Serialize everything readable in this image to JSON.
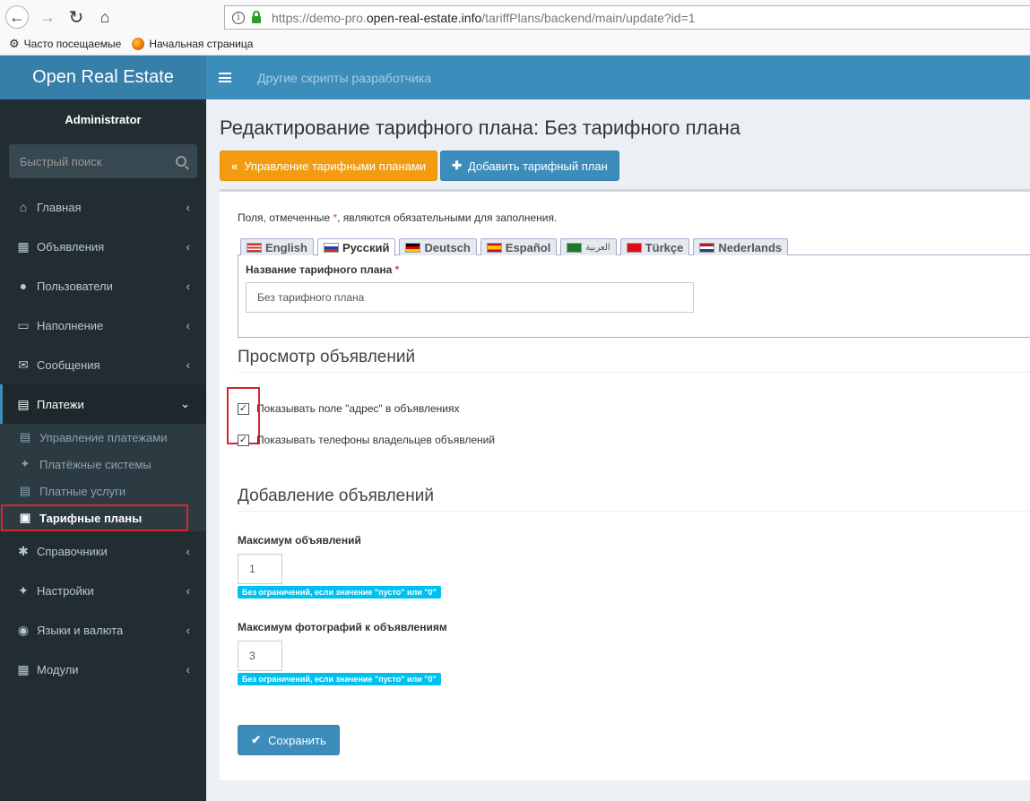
{
  "browser": {
    "url_prefix": "https://demo-pro.",
    "url_host": "open-real-estate.info",
    "url_path": "/tariffPlans/backend/main/update?id=1",
    "bookmarks": [
      "Часто посещаемые",
      "Начальная страница"
    ]
  },
  "sidebar": {
    "logo": "Open Real Estate",
    "user": "Administrator",
    "search_placeholder": "Быстрый поиск",
    "items": [
      {
        "label": "Главная",
        "icon": "home-icon"
      },
      {
        "label": "Объявления",
        "icon": "grid-icon"
      },
      {
        "label": "Пользователи",
        "icon": "user-icon"
      },
      {
        "label": "Наполнение",
        "icon": "folder-open-icon"
      },
      {
        "label": "Сообщения",
        "icon": "envelope-icon"
      },
      {
        "label": "Платежи",
        "icon": "cart-icon"
      },
      {
        "label": "Справочники",
        "icon": "asterisk-icon"
      },
      {
        "label": "Настройки",
        "icon": "wrench-icon"
      },
      {
        "label": "Языки и валюта",
        "icon": "globe-icon"
      },
      {
        "label": "Модули",
        "icon": "modules-grid-icon"
      }
    ],
    "payments_sub": [
      {
        "label": "Управление платежами",
        "icon": "list-icon"
      },
      {
        "label": "Платёжные системы",
        "icon": "wrench-icon"
      },
      {
        "label": "Платные услуги",
        "icon": "cart-icon"
      },
      {
        "label": "Тарифные планы",
        "icon": "briefcase-icon"
      }
    ]
  },
  "topbar": {
    "link": "Другие скрипты разработчика"
  },
  "page": {
    "title": "Редактирование тарифного плана: Без тарифного плана",
    "btn_manage": "Управление тарифными планами",
    "btn_add": "Добавить тарифный план",
    "required_note_pre": "Поля, отмеченные ",
    "required_mark": "*",
    "required_note_post": ", являются обязательными для заполнения.",
    "tabs": [
      "English",
      "Русский",
      "Deutsch",
      "Español",
      "العربية",
      "Türkçe",
      "Nederlands"
    ],
    "active_tab": "Русский",
    "name_label": "Название тарифного плана",
    "name_value": "Без тарифного плана",
    "section_view": "Просмотр объявлений",
    "cb_address": "Показывать поле \"адрес\" в объявлениях",
    "cb_phones": "Показывать телефоны владельцев объявлений",
    "section_add": "Добавление объявлений",
    "max_ads_label": "Максимум объявлений",
    "max_ads_value": "1",
    "hint": "Без ограничений, если значение \"пусто\" или \"0\"",
    "max_photos_label": "Максимум фотографий к объявлениям",
    "max_photos_value": "3",
    "save": "Сохранить"
  },
  "colors": {
    "sidebar": "#222d32",
    "logo": "#367fa9",
    "topbar": "#3c8dbc",
    "warning": "#f39c12",
    "info": "#00c0ef",
    "highlight": "#d9262c"
  }
}
